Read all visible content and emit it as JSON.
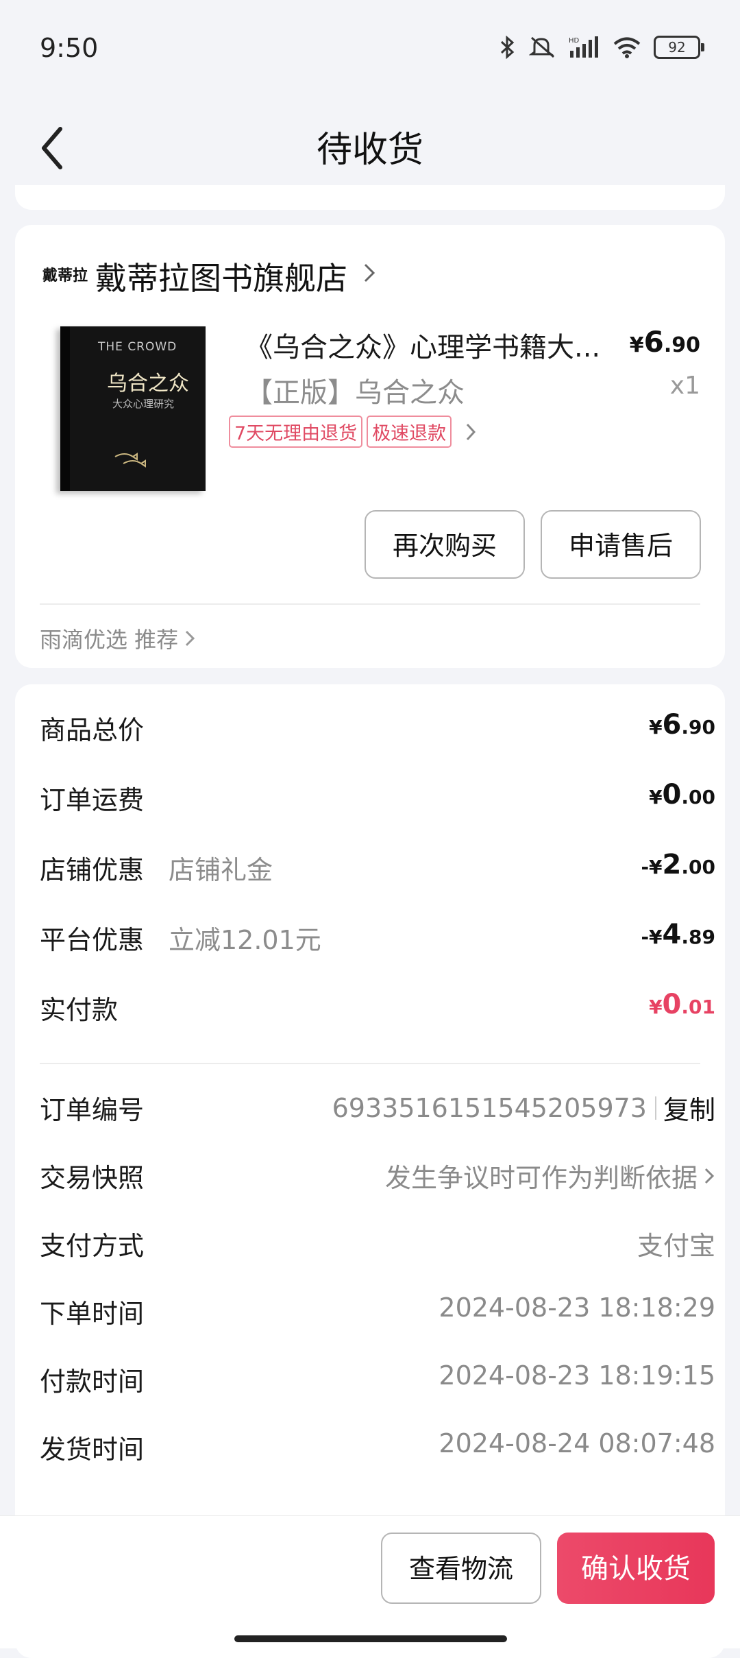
{
  "status_bar": {
    "time": "9:50",
    "battery": "92",
    "network": "HD"
  },
  "header": {
    "title": "待收货"
  },
  "shop": {
    "logo_text": "戴蒂拉",
    "name": "戴蒂拉图书旗舰店",
    "product": {
      "cover_title_en": "THE CROWD",
      "cover_title_cn": "乌合之众",
      "cover_subtitle": "大众心理研究",
      "title": "《乌合之众》心理学书籍大...",
      "variant": "【正版】乌合之众",
      "price_symbol": "¥",
      "price_int": "6",
      "price_dec": ".90",
      "qty": "x1",
      "tags": [
        "7天无理由退货",
        "极速退款"
      ]
    },
    "buttons": {
      "buy_again": "再次购买",
      "after_sale": "申请售后"
    },
    "recommend": "雨滴优选 推荐"
  },
  "summary": {
    "goods_total": {
      "label": "商品总价",
      "sym": "¥",
      "int": "6",
      "dec": ".90"
    },
    "shipping": {
      "label": "订单运费",
      "sym": "¥",
      "int": "0",
      "dec": ".00"
    },
    "shop_discount": {
      "label": "店铺优惠",
      "sub": "店铺礼金",
      "sym": "-¥",
      "int": "2",
      "dec": ".00"
    },
    "platform_discount": {
      "label": "平台优惠",
      "sub": "立减12.01元",
      "sym": "-¥",
      "int": "4",
      "dec": ".89"
    },
    "paid": {
      "label": "实付款",
      "sym": "¥",
      "int": "0",
      "dec": ".01"
    }
  },
  "order_info": {
    "order_no": {
      "label": "订单编号",
      "value": "6933516151545205973",
      "copy": "复制"
    },
    "snapshot": {
      "label": "交易快照",
      "value": "发生争议时可作为判断依据"
    },
    "payment": {
      "label": "支付方式",
      "value": "支付宝"
    },
    "order_time": {
      "label": "下单时间",
      "value": "2024-08-23 18:18:29"
    },
    "pay_time": {
      "label": "付款时间",
      "value": "2024-08-23 18:19:15"
    },
    "ship_time": {
      "label": "发货时间",
      "value": "2024-08-24 08:07:48"
    }
  },
  "bottom": {
    "logistics": "查看物流",
    "confirm": "确认收货"
  },
  "colors": {
    "accent": "#e8375a",
    "tag_border": "#ef8d9d",
    "background": "#f3f4f8"
  }
}
